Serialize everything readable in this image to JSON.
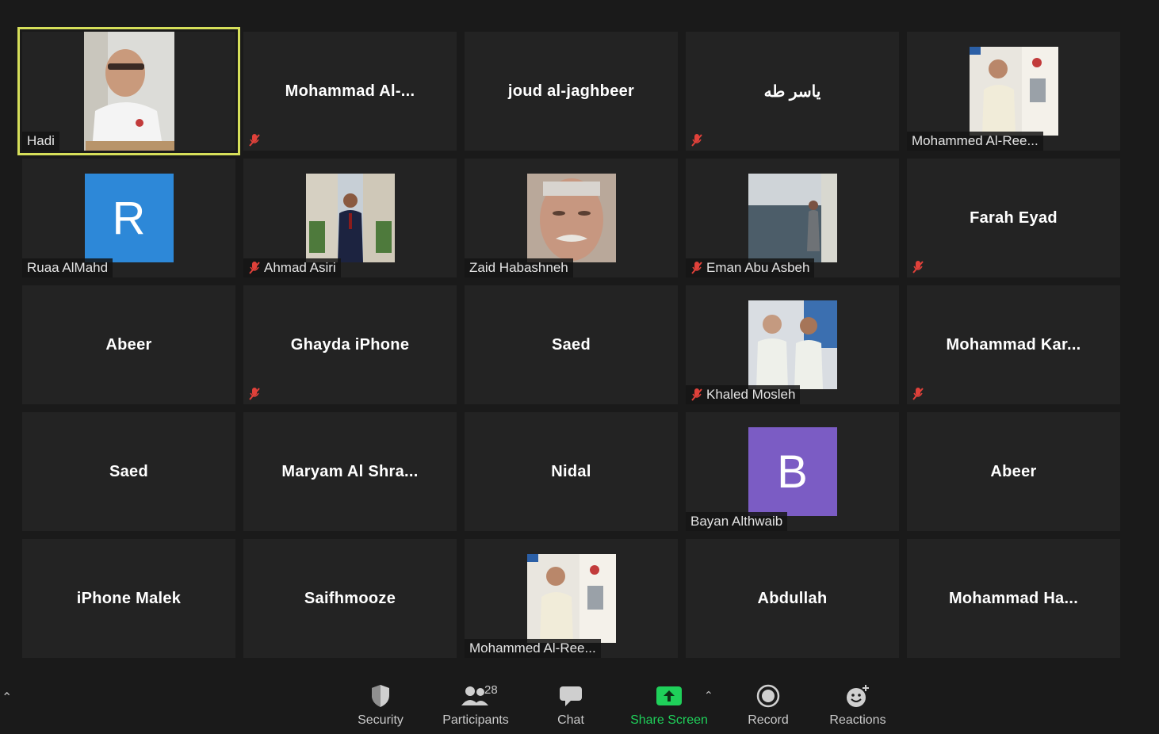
{
  "participants": [
    {
      "name": "Hadi",
      "type": "video",
      "muted": false,
      "active": true
    },
    {
      "name": "Mohammad  Al-...",
      "type": "name",
      "muted": true
    },
    {
      "name": "joud al-jaghbeer",
      "type": "name",
      "muted": false
    },
    {
      "name": "ياسر طه",
      "type": "name",
      "muted": true
    },
    {
      "name": "Mohammed Al-Ree...",
      "type": "photo",
      "muted": false
    },
    {
      "name": "Ruaa AlMahd",
      "type": "letter",
      "letter": "R",
      "color": "#2d88d8",
      "muted": false
    },
    {
      "name": "Ahmad Asiri",
      "type": "photo",
      "muted": true
    },
    {
      "name": "Zaid Habashneh",
      "type": "photo",
      "muted": false
    },
    {
      "name": "Eman Abu Asbeh",
      "type": "photo",
      "muted": true
    },
    {
      "name": "Farah Eyad",
      "type": "name",
      "muted": true
    },
    {
      "name": "Abeer",
      "type": "name",
      "muted": false
    },
    {
      "name": "Ghayda iPhone",
      "type": "name",
      "muted": true
    },
    {
      "name": "Saed",
      "type": "name",
      "muted": false
    },
    {
      "name": "Khaled Mosleh",
      "type": "photo",
      "muted": true
    },
    {
      "name": "Mohammad  Kar...",
      "type": "name",
      "muted": true
    },
    {
      "name": "Saed",
      "type": "name",
      "muted": false
    },
    {
      "name": "Maryam  Al Shra...",
      "type": "name",
      "muted": false
    },
    {
      "name": "Nidal",
      "type": "name",
      "muted": false
    },
    {
      "name": "Bayan Althwaib",
      "type": "letter",
      "letter": "B",
      "color": "#7b5cc4",
      "muted": false
    },
    {
      "name": "Abeer",
      "type": "name",
      "muted": false
    },
    {
      "name": "iPhone  Malek",
      "type": "name",
      "muted": false
    },
    {
      "name": "Saifhmooze",
      "type": "name",
      "muted": false
    },
    {
      "name": "Mohammed Al-Ree...",
      "type": "photo",
      "muted": false
    },
    {
      "name": "Abdullah",
      "type": "name",
      "muted": false
    },
    {
      "name": "Mohammad  Ha...",
      "type": "name",
      "muted": false
    }
  ],
  "toolbar": {
    "security_label": "Security",
    "participants_label": "Participants",
    "participants_count": "28",
    "chat_label": "Chat",
    "share_label": "Share Screen",
    "record_label": "Record",
    "reactions_label": "Reactions"
  },
  "colors": {
    "active_speaker_border": "#d6df5a",
    "muted_icon": "#e0413a",
    "share_green": "#1fd05a"
  }
}
